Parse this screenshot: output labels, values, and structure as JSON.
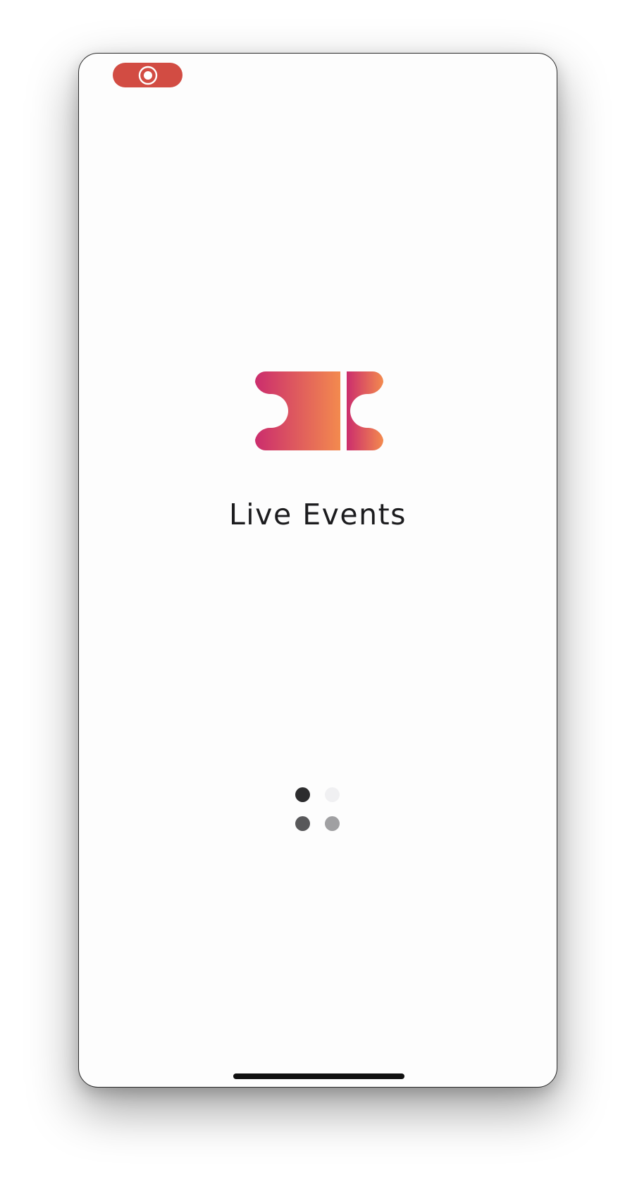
{
  "app": {
    "title": "Live Events",
    "logo_icon": "ticket-icon",
    "logo_gradient": [
      "#cb2d6d",
      "#f38a4e"
    ]
  },
  "status_bar": {
    "recording_icon": "screen-recording-icon",
    "recording_color": "#d24c43"
  },
  "loading": {
    "icon": "loading-dots-icon",
    "dot_colors": [
      "#2c2c2e",
      "#f0f0f2",
      "#58585a",
      "#a0a0a2"
    ]
  },
  "home_indicator": {
    "color": "#111111"
  }
}
